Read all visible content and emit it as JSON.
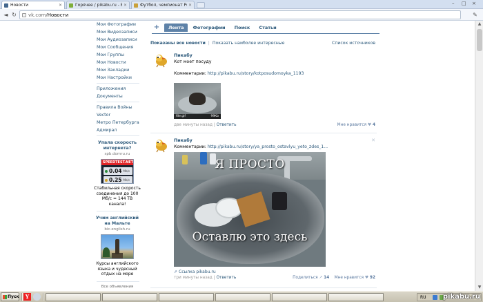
{
  "browser": {
    "tabs": [
      {
        "title": "Новости",
        "active": true,
        "favicon_color": "#45688e"
      },
      {
        "title": "Горячее / pikabu.ru - В",
        "active": false,
        "favicon_color": "#7fae3a"
      },
      {
        "title": "Футбол, чемпионат Ро",
        "active": false,
        "favicon_color": "#c9a13a"
      }
    ],
    "address_host": "vk.com",
    "address_sep": " / ",
    "address_path": "Новости"
  },
  "sidebar": {
    "items": [
      "Мои Фотографии",
      "Мои Видеозаписи",
      "Мои Аудиозаписи",
      "Мои Сообщения",
      "Мои Группы",
      "Мои Новости",
      "Мои Закладки",
      "Мои Настройки"
    ],
    "items2": [
      "Приложения",
      "Документы"
    ],
    "items3": [
      "Правила Войны",
      "Vector",
      "Метро Петербурга",
      "Адмирал"
    ],
    "ad1": {
      "title": "Упала скорость интернета?",
      "domain": "spb.domru.ru",
      "logo": "SPEEDTEST.NET",
      "down": "0.04",
      "up": "0.25",
      "unit": "Mb/s",
      "text": "Стабильная скорость соединения до 100 Мб/с = 144 ТВ канала!"
    },
    "ad2": {
      "title": "Учим английский на Мальте",
      "domain": "bic-english.ru",
      "text": "Курсы английского языка и чудесный отдых на море"
    },
    "all_ads": "Все объявления"
  },
  "feed": {
    "add": "+",
    "tabs": [
      "Лента",
      "Фотографии",
      "Поиск",
      "Статьи"
    ],
    "filter_current": "Показаны все новости",
    "filter_sep": "|",
    "filter_other": "Показать наиболее интересные",
    "sources": "Список источников",
    "posts": [
      {
        "author": "Пикабу",
        "text": "Кот моет посуду",
        "comment_label": "Комментарии: ",
        "comment_url": "http://pikabu.ru/story/kotposudomoyka_1193",
        "thumb_left": "file.gif",
        "thumb_right": "99Kb",
        "time": "две минуты назад",
        "sep": " | ",
        "reply": "Ответить",
        "likes_label": "Мне нравится",
        "likes": "4"
      },
      {
        "author": "Пикабу",
        "comment_label": "Комментарии: ",
        "comment_url": "http://pikabu.ru/story/ya_prosto_ostavlyu_yeto_zdes_1...",
        "meme_top": "Я ПРОСТО",
        "meme_bottom": "Оставлю это здесь",
        "link_label": "Ссылка ",
        "link_domain": "pikabu.ru",
        "time": "три минуты назад",
        "sep": " | ",
        "reply": "Ответить",
        "share_label": "Поделиться",
        "shares": "14",
        "likes_label": "Мне нравится",
        "likes": "92"
      }
    ]
  },
  "taskbar": {
    "start": "Пуск",
    "ql_y": "Y",
    "lang": "RU"
  },
  "watermark": "pikabu.ru"
}
